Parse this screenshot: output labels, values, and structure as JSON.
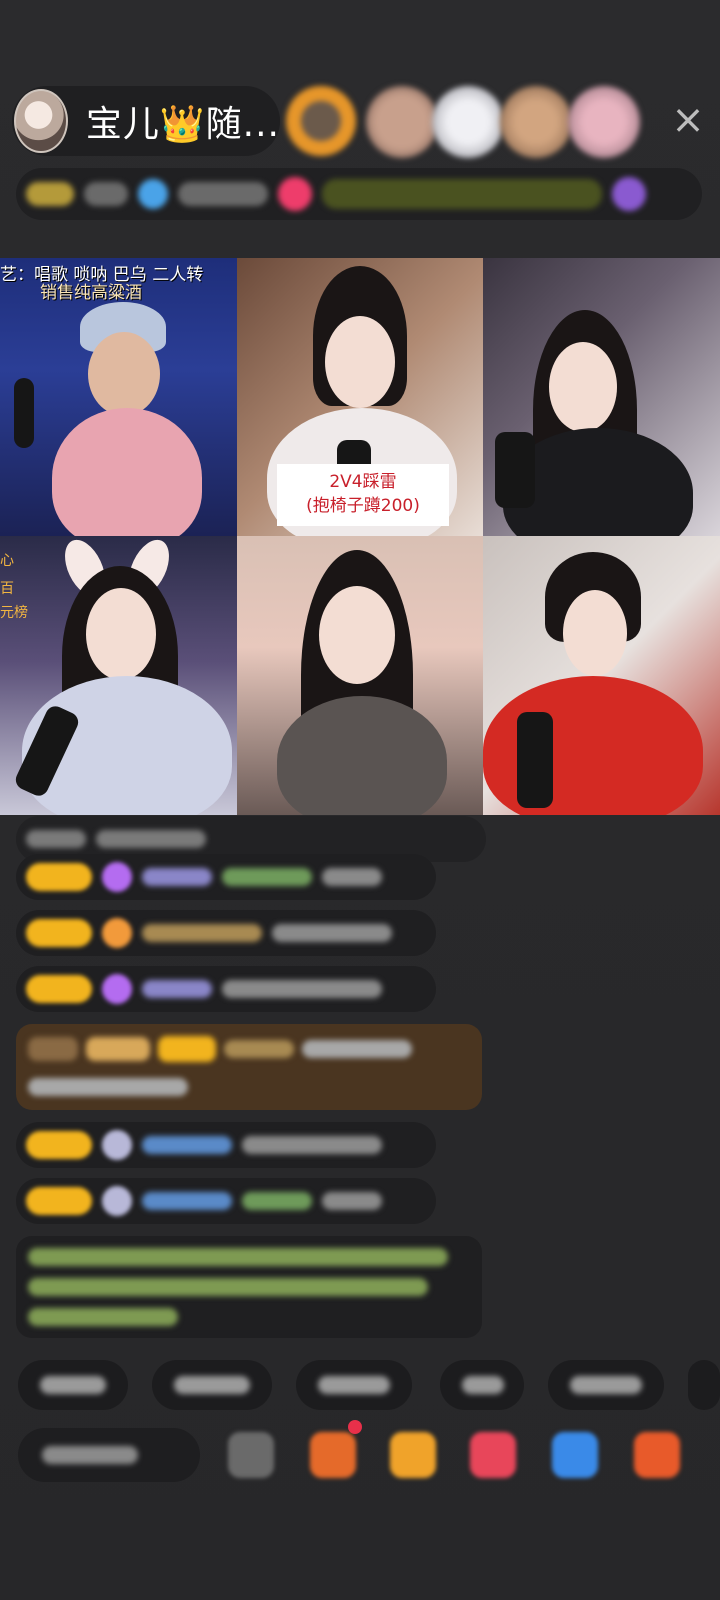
{
  "header": {
    "host_name": "宝儿👑随...",
    "close_icon": "close-icon",
    "viewers": [
      {
        "color": "#e6962a"
      },
      {
        "color": "#c8a08c"
      },
      {
        "color": "#d8d8e0"
      },
      {
        "color": "#d2a580"
      },
      {
        "color": "#e8b4c0"
      }
    ]
  },
  "grid": {
    "cell1_line1": "艺：唱歌 唢呐 巴乌 二人转",
    "cell1_line2": "销售纯高粱酒",
    "cell2_sign_line1": "2V4踩雷",
    "cell2_sign_line2": "(抱椅子蹲200)",
    "cell4_side1": "心",
    "cell4_side2": "百",
    "cell4_side3": "元榜"
  },
  "colors": {
    "badge": "#f2b41e",
    "accent_green": "#9acd62",
    "purple_gem": "#b46cf0",
    "orange_gem": "#f29a3b"
  }
}
